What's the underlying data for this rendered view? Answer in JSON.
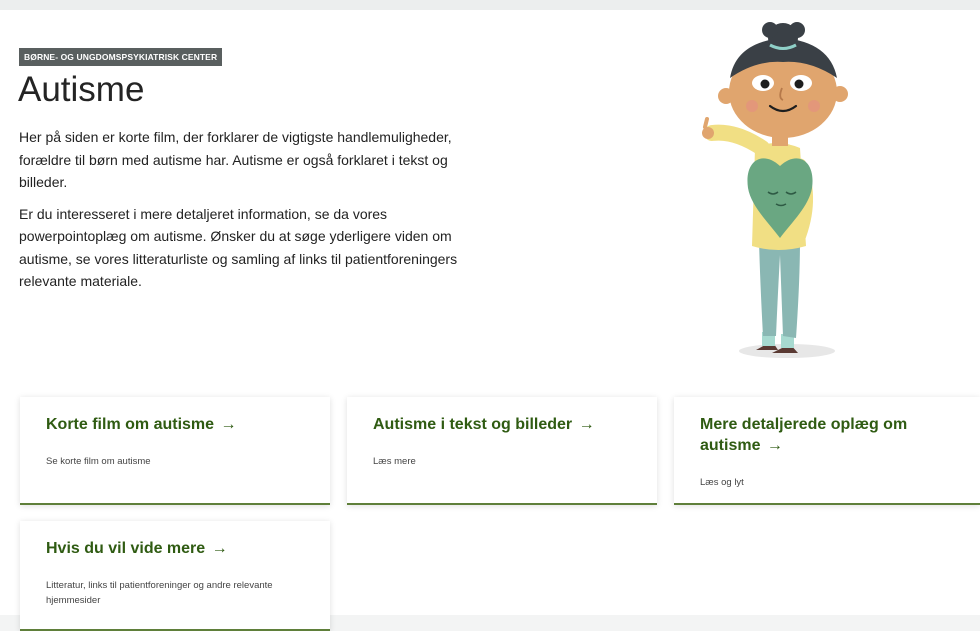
{
  "header": {
    "section_label": "BØRNE- OG UNGDOMSPSYKIATRISK CENTER",
    "title": "Autisme"
  },
  "intro": {
    "paragraph1": "Her på siden er korte film, der forklarer de vigtigste handlemuligheder, forældre til børn med autisme har. Autisme er også forklaret i tekst og billeder.",
    "paragraph2": "Er du interesseret i mere detaljeret information, se da vores powerpointoplæg om autisme. Ønsker du at søge yderligere viden om autisme, se vores litteraturliste og samling af links til patientforeningers relevante materiale."
  },
  "cards": [
    {
      "title": "Korte film om autisme",
      "desc": "Se korte film om autisme"
    },
    {
      "title": "Autisme i tekst og billeder",
      "desc": "Læs mere"
    },
    {
      "title": "Mere detaljerede oplæg om autisme",
      "desc": "Læs og lyt"
    },
    {
      "title": "Hvis du vil vide mere",
      "desc": "Litteratur, links til patientforeninger og andre relevante hjemmesider"
    }
  ],
  "arrow_glyph": "→",
  "colors": {
    "link_green": "#2f5b12",
    "card_border": "#5f7f3a",
    "badge_bg": "#595f5f",
    "heart_green": "#6aa782",
    "sweater_yellow": "#f1df84",
    "skin": "#e0a56e",
    "hair": "#3a4046"
  },
  "illustration_icon": "child-with-heart-illustration"
}
